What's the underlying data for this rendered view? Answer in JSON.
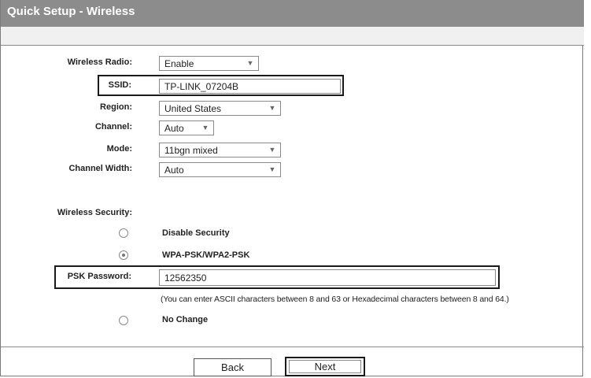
{
  "header": {
    "title": "Quick Setup - Wireless"
  },
  "form": {
    "wireless_radio": {
      "label": "Wireless Radio:",
      "value": "Enable"
    },
    "ssid": {
      "label": "SSID:",
      "value": "TP-LINK_07204B"
    },
    "region": {
      "label": "Region:",
      "value": "United States"
    },
    "channel": {
      "label": "Channel:",
      "value": "Auto"
    },
    "mode": {
      "label": "Mode:",
      "value": "11bgn mixed"
    },
    "channel_width": {
      "label": "Channel Width:",
      "value": "Auto"
    },
    "security": {
      "label": "Wireless Security:",
      "options": [
        {
          "label": "Disable Security",
          "selected": false
        },
        {
          "label": "WPA-PSK/WPA2-PSK",
          "selected": true
        }
      ],
      "psk_label": "PSK Password:",
      "psk_value": "12562350",
      "psk_note": "(You can enter ASCII characters between 8 and 63 or Hexadecimal characters between 8 and 64.)",
      "no_change": {
        "label": "No Change",
        "selected": false
      }
    }
  },
  "buttons": {
    "back": "Back",
    "next": "Next"
  },
  "icons": {
    "dropdown": "chevron-down-icon"
  }
}
